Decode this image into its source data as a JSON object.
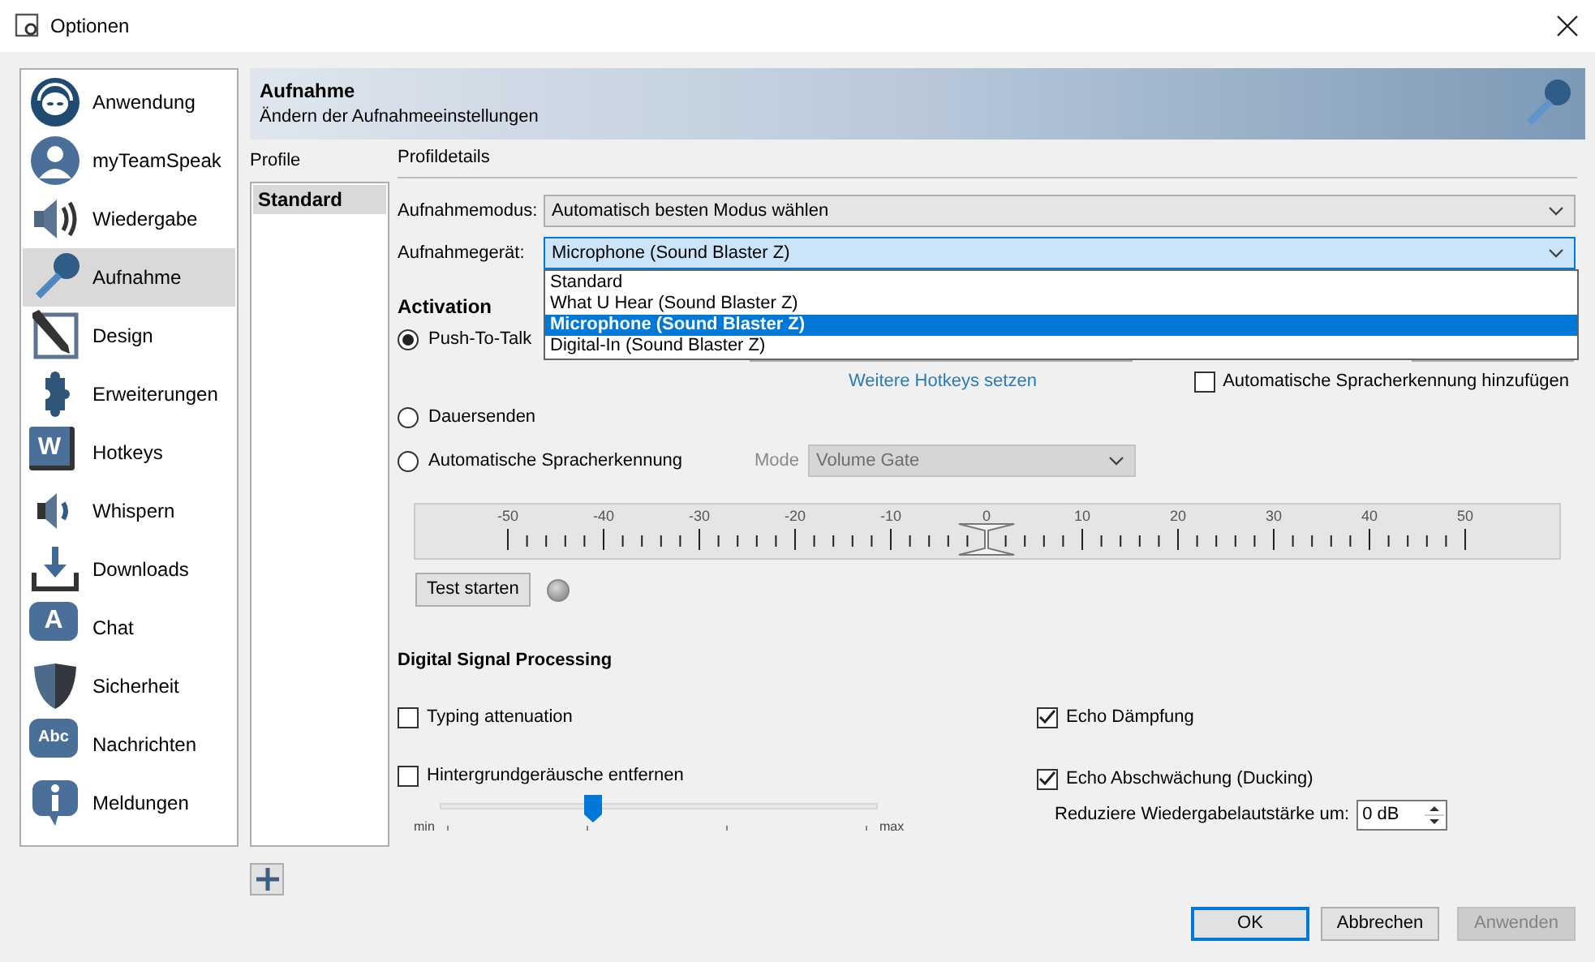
{
  "window": {
    "title": "Optionen"
  },
  "sidebar": {
    "items": [
      {
        "label": "Anwendung",
        "selected": false
      },
      {
        "label": "myTeamSpeak",
        "selected": false
      },
      {
        "label": "Wiedergabe",
        "selected": false
      },
      {
        "label": "Aufnahme",
        "selected": true
      },
      {
        "label": "Design",
        "selected": false
      },
      {
        "label": "Erweiterungen",
        "selected": false
      },
      {
        "label": "Hotkeys",
        "selected": false,
        "icon_text": "W"
      },
      {
        "label": "Whispern",
        "selected": false
      },
      {
        "label": "Downloads",
        "selected": false
      },
      {
        "label": "Chat",
        "selected": false,
        "icon_text": "A"
      },
      {
        "label": "Sicherheit",
        "selected": false
      },
      {
        "label": "Nachrichten",
        "selected": false,
        "icon_text": "Abc"
      },
      {
        "label": "Meldungen",
        "selected": false
      }
    ]
  },
  "header": {
    "title": "Aufnahme",
    "subtitle": "Ändern der Aufnahmeeinstellungen"
  },
  "profiles": {
    "label": "Profile",
    "items": [
      {
        "label": "Standard",
        "selected": true
      }
    ]
  },
  "details": {
    "label": "Profildetails",
    "mode": {
      "label": "Aufnahmemodus:",
      "value": "Automatisch besten Modus wählen"
    },
    "device": {
      "label": "Aufnahmegerät:",
      "value": "Microphone (Sound Blaster Z)",
      "expanded": true,
      "options": [
        {
          "label": "Standard",
          "selected": false
        },
        {
          "label": "What U Hear (Sound Blaster Z)",
          "selected": false
        },
        {
          "label": "Microphone (Sound Blaster Z)",
          "selected": true
        },
        {
          "label": "Digital-In (Sound Blaster Z)",
          "selected": false
        }
      ]
    },
    "activation": {
      "heading": "Activation",
      "options": [
        {
          "label": "Push-To-Talk",
          "selected": true
        },
        {
          "label": "Dauersenden",
          "selected": false
        },
        {
          "label": "Automatische Spracherkennung",
          "selected": false
        }
      ],
      "hotkeys_link": "Weitere Hotkeys setzen",
      "add_vad": {
        "label": "Automatische Spracherkennung hinzufügen",
        "checked": false
      },
      "vad_mode": {
        "label": "Mode",
        "value": "Volume Gate",
        "disabled": true
      }
    },
    "threshold": {
      "level": 0.5,
      "scale_labels": [
        "-50",
        "-40",
        "-30",
        "-20",
        "-10",
        "0",
        "10",
        "20",
        "30",
        "40",
        "50"
      ]
    },
    "test_button": "Test starten",
    "dsp": {
      "heading": "Digital Signal Processing",
      "typing": {
        "label": "Typing attenuation",
        "checked": false
      },
      "noise": {
        "label": "Hintergrundgeräusche entfernen",
        "checked": false,
        "level": 0.34,
        "min": "min",
        "max": "max"
      },
      "echo_cancel": {
        "label": "Echo Dämpfung",
        "checked": true
      },
      "ducking": {
        "label": "Echo Abschwächung (Ducking)",
        "checked": true
      },
      "reduce": {
        "label": "Reduziere Wiedergabelautstärke um:",
        "value": "0 dB"
      }
    }
  },
  "buttons": [
    {
      "label": "OK",
      "default": true,
      "disabled": false
    },
    {
      "label": "Abbrechen",
      "default": false,
      "disabled": false
    },
    {
      "label": "Anwenden",
      "default": false,
      "disabled": true
    }
  ]
}
